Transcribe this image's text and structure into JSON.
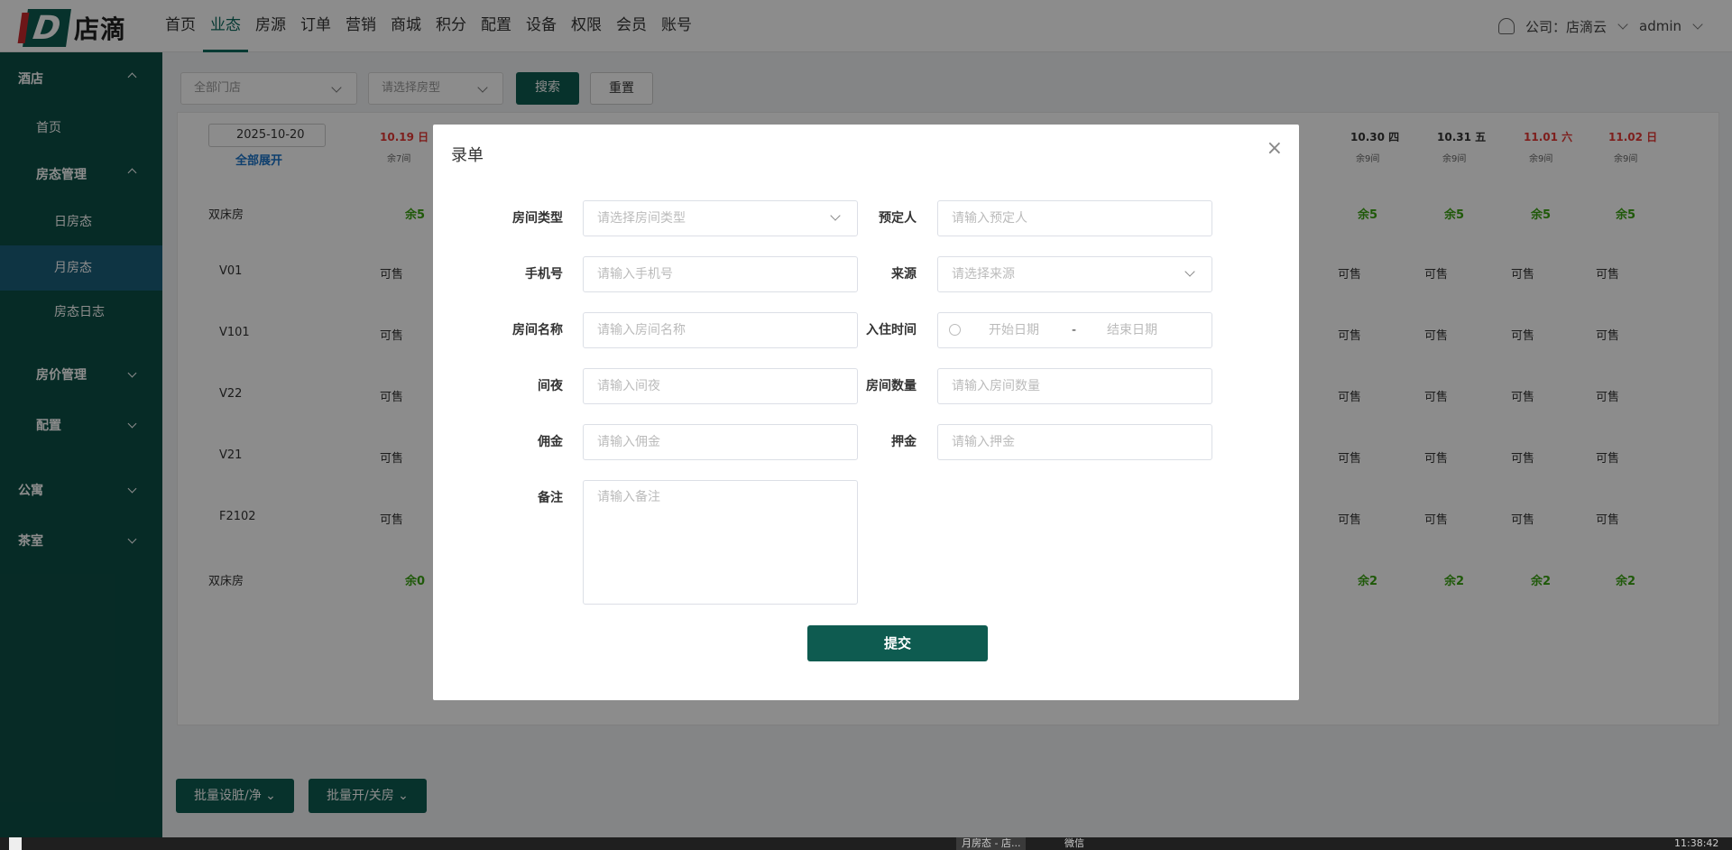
{
  "brand": {
    "logo_letter": "D",
    "name": "店滴"
  },
  "nav": [
    "首页",
    "业态",
    "房源",
    "订单",
    "营销",
    "商城",
    "积分",
    "配置",
    "设备",
    "权限",
    "会员",
    "账号"
  ],
  "header": {
    "company": "公司：店滴云",
    "user": "admin"
  },
  "sidebar": {
    "hotel": "酒店",
    "home": "首页",
    "room_status_mgmt": "房态管理",
    "daily": "日房态",
    "monthly": "月房态",
    "log": "房态日志",
    "price_mgmt": "房价管理",
    "config": "配置",
    "apartment": "公寓",
    "tearoom": "茶室"
  },
  "filters": {
    "store": "全部门店",
    "room_type": "请选择房型",
    "search": "搜索",
    "reset": "重置"
  },
  "grid": {
    "date_value": "2025-10-20",
    "expand_all": "全部展开",
    "col_left": {
      "date": "10.19 日",
      "remain": "余7间"
    },
    "cols_right": [
      {
        "date": "10.30 四",
        "remain": "余9间",
        "weekend": false
      },
      {
        "date": "10.31 五",
        "remain": "余9间",
        "weekend": false
      },
      {
        "date": "11.01 六",
        "remain": "余9间",
        "weekend": true
      },
      {
        "date": "11.02 日",
        "remain": "余9间",
        "weekend": true
      }
    ],
    "group1": {
      "name": "双床房",
      "left": "余5",
      "right": [
        "余5",
        "余5",
        "余5",
        "余5"
      ]
    },
    "rooms": [
      "V01",
      "V101",
      "V22",
      "V21",
      "F2102"
    ],
    "status": "可售",
    "group2": {
      "name": "双床房",
      "left": "余0",
      "right": [
        "余2",
        "余2",
        "余2",
        "余2"
      ]
    }
  },
  "bottom": {
    "batch_clean": "批量设脏/净",
    "batch_open": "批量开/关房"
  },
  "modal": {
    "title": "录单",
    "close": "×",
    "fields": {
      "room_type_label": "房间类型",
      "room_type_ph": "请选择房间类型",
      "booker_label": "预定人",
      "booker_ph": "请输入预定人",
      "phone_label": "手机号",
      "phone_ph": "请输入手机号",
      "source_label": "来源",
      "source_ph": "请选择来源",
      "room_name_label": "房间名称",
      "room_name_ph": "请输入房间名称",
      "checkin_label": "入住时间",
      "start_ph": "开始日期",
      "sep": "-",
      "end_ph": "结束日期",
      "nights_label": "间夜",
      "nights_ph": "请输入间夜",
      "room_count_label": "房间数量",
      "room_count_ph": "请输入房间数量",
      "commission_label": "佣金",
      "commission_ph": "请输入佣金",
      "deposit_label": "押金",
      "deposit_ph": "请输入押金",
      "remark_label": "备注",
      "remark_ph": "请输入备注"
    },
    "submit": "提交"
  },
  "taskbar": {
    "item1": "月房态 - 店...",
    "item2": "微信",
    "clock": "11:38:42"
  },
  "colors": {
    "primary": "#0e5b50",
    "sidebar": "#0c4f45",
    "active_sidebar": "#1a5f7a",
    "available": "#3aa312",
    "weekend": "#e53935"
  }
}
